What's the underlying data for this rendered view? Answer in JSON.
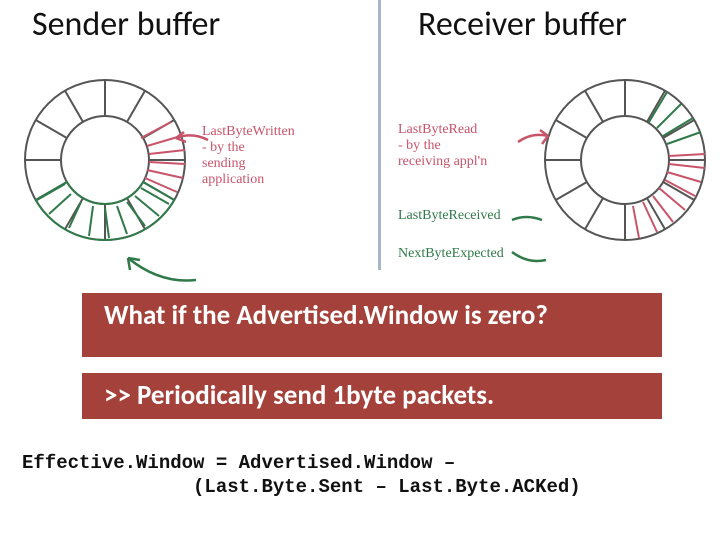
{
  "headings": {
    "left": "Sender buffer",
    "right": "Receiver buffer"
  },
  "annotations": {
    "sender_last_byte_written": "LastByteWritten\n- by the\n  sending\n  application",
    "receiver_last_byte_read": "LastByteRead\n- by the\n  receiving appl'n",
    "receiver_last_byte_received": "LastByteReceived",
    "receiver_next_byte_expected": "NextByteExpected"
  },
  "questions": {
    "what_if_zero": "What if the Advertised.Window is zero?",
    "answer": ">> Periodically send 1byte packets."
  },
  "formula": {
    "line1": "Effective.Window = Advertised.Window –",
    "line2": "               (Last.Byte.Sent – Last.Byte.ACKed)"
  },
  "icons": {
    "ring": "segmented-ring",
    "arrow": "handwritten-arrow"
  }
}
